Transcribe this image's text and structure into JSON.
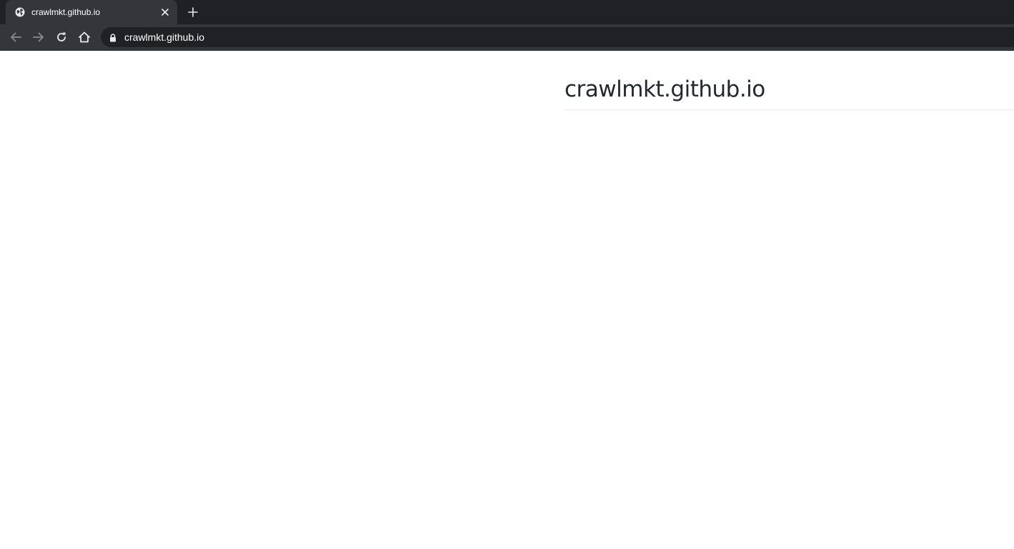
{
  "browser": {
    "tab": {
      "title": "crawlmkt.github.io",
      "favicon": "globe-icon"
    },
    "new_tab_icon": "plus-icon",
    "close_icon": "close-icon",
    "toolbar": {
      "back_icon": "back-arrow-icon",
      "forward_icon": "forward-arrow-icon",
      "reload_icon": "reload-icon",
      "home_icon": "home-icon",
      "lock_icon": "lock-icon",
      "url": "crawlmkt.github.io"
    },
    "colors": {
      "tabstrip": "#202124",
      "toolbar": "#35363a",
      "omnibox": "#202124"
    }
  },
  "page": {
    "heading": "crawlmkt.github.io",
    "colors": {
      "heading": "#24292e",
      "rule": "#eaecef"
    }
  }
}
